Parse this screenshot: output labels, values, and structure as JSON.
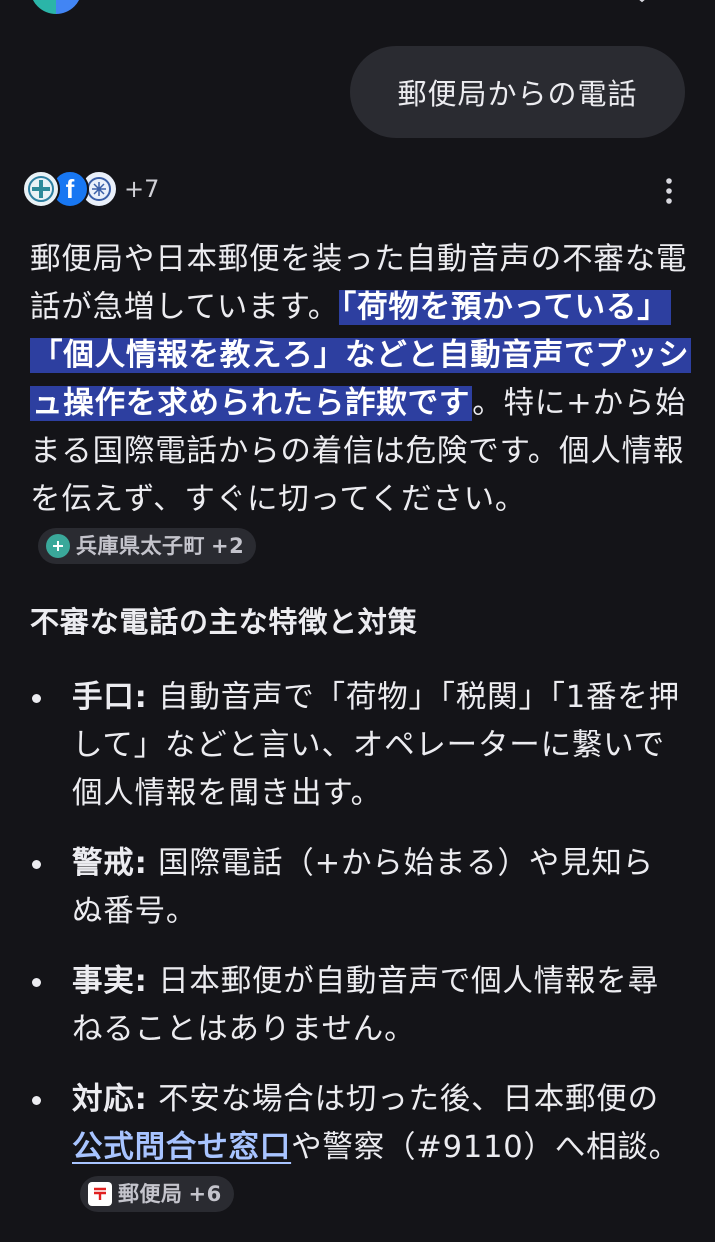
{
  "user_query": "郵便局からの電話",
  "sources": {
    "count_label": "+7",
    "icons": [
      "bank-logo-icon",
      "facebook-icon",
      "emblem-icon"
    ]
  },
  "answer": {
    "p1_a": "郵便局や日本郵便を装った自動音声の不審な電話が急増しています。",
    "p1_highlight": "「荷物を預かっている」「個人情報を教えろ」などと自動音声でプッシュ操作を求められたら詐欺です",
    "p1_b": "。特に+から始まる国際電話からの着信は危険です。個人情報を伝えず、すぐに切ってください。",
    "chip1": {
      "label": "兵庫県太子町",
      "count": "+2"
    }
  },
  "section": {
    "heading": "不審な電話の主な特徴と対策"
  },
  "bullets": {
    "b1": {
      "label": "手口:",
      "text": " 自動音声で「荷物」「税関」「1番を押して」などと言い、オペレーターに繋いで個人情報を聞き出す。"
    },
    "b2": {
      "label": "警戒:",
      "text": " 国際電話（+から始まる）や見知らぬ番号。"
    },
    "b3": {
      "label": "事実:",
      "text": " 日本郵便が自動音声で個人情報を尋ねることはありません。"
    },
    "b4": {
      "label": "対応:",
      "text_a": " 不安な場合は切った後、日本郵便の",
      "link": "公式問合せ窓口",
      "text_b": "や警察（#9110）へ相談。",
      "chip": {
        "label": "郵便局",
        "count": "+6"
      }
    }
  },
  "colors": {
    "background": "#141418",
    "bubble": "#2a2b31",
    "highlight": "#2d3fa0",
    "link": "#a8c4ff"
  }
}
